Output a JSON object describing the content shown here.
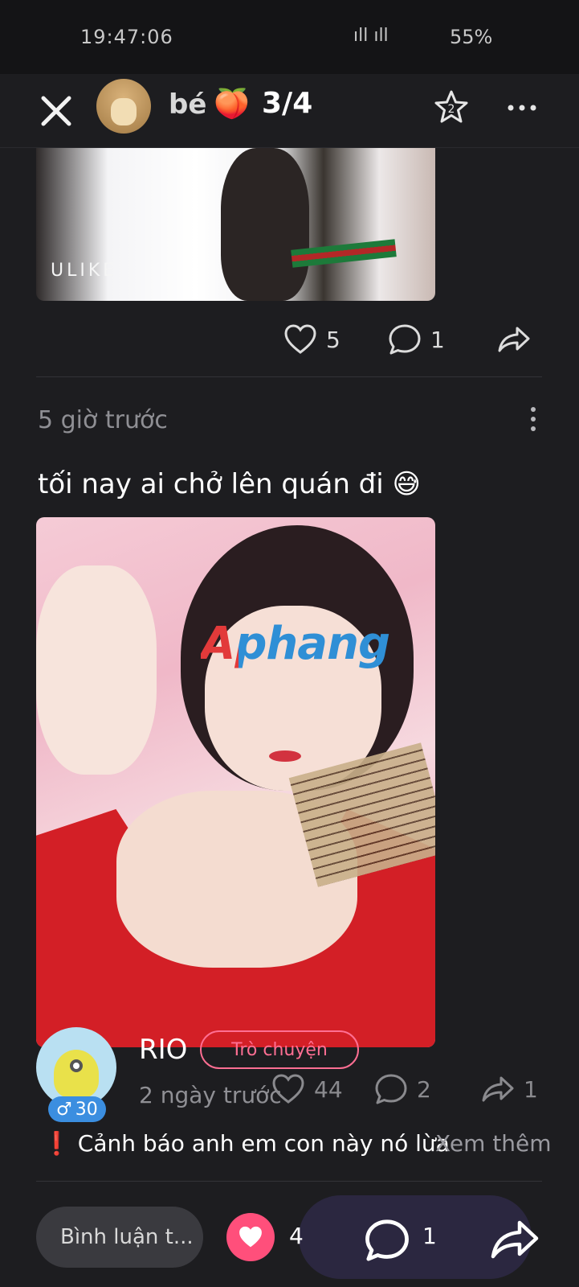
{
  "status_bar": {
    "time": "19:47:06",
    "signal": "ıll ıll",
    "battery": "55%"
  },
  "header": {
    "name": "bé",
    "emoji": "🍑",
    "counter": "3/4"
  },
  "post_prev": {
    "watermark": "ULIKE",
    "likes": "5",
    "comments": "1"
  },
  "post": {
    "time_ago": "5 giờ trước",
    "text": "tối nay ai chở lên quán đi 😅",
    "watermark": "Aphang"
  },
  "comment": {
    "username": "RIO",
    "chat_label": "Trò chuyện",
    "gender_age": "30",
    "time_ago": "2 ngày trước",
    "likes": "44",
    "replies": "2",
    "shares": "1",
    "text": "❗ Cảnh báo anh em con này nó lừa",
    "see_more": "Xem thêm"
  },
  "bottom_bar": {
    "comment_placeholder": "Bình luận t...",
    "like_count": "4",
    "comment_count": "1"
  },
  "colors": {
    "accent_pink": "#ff4f7b",
    "badge_blue": "#3b8ee0",
    "background": "#1d1d20"
  }
}
